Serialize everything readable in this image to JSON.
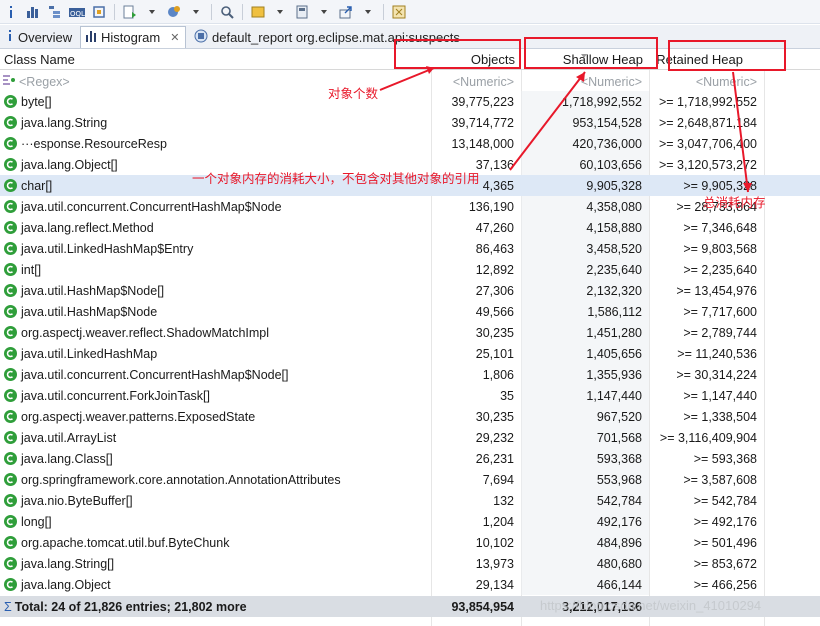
{
  "tabs": [
    {
      "label": "Overview",
      "icon": "info-icon"
    },
    {
      "label": "Histogram",
      "icon": "histogram-icon"
    },
    {
      "label": "default_report  org.eclipse.mat.api:suspects",
      "icon": "report-icon"
    }
  ],
  "columns": {
    "class_name": "Class Name",
    "objects": "Objects",
    "shallow": "Shallow Heap",
    "retained": "Retained Heap"
  },
  "filters": {
    "regex": "<Regex>",
    "objects": "<Numeric>",
    "shallow": "<Numeric>",
    "retained": "<Numeric>"
  },
  "rows": [
    {
      "name": "byte[]",
      "objects": "39,775,223",
      "shallow": "1,718,992,552",
      "retained": ">= 1,718,992,552"
    },
    {
      "name": "java.lang.String",
      "objects": "39,714,772",
      "shallow": "953,154,528",
      "retained": ">= 2,648,871,184"
    },
    {
      "name": "···esponse.ResourceResp",
      "objects": "13,148,000",
      "shallow": "420,736,000",
      "retained": ">= 3,047,706,400"
    },
    {
      "name": "java.lang.Object[]",
      "objects": "37,136",
      "shallow": "60,103,656",
      "retained": ">= 3,120,573,272"
    },
    {
      "name": "char[]",
      "objects": "4,365",
      "shallow": "9,905,328",
      "retained": ">= 9,905,328"
    },
    {
      "name": "java.util.concurrent.ConcurrentHashMap$Node",
      "objects": "136,190",
      "shallow": "4,358,080",
      "retained": ">= 28,733,864"
    },
    {
      "name": "java.lang.reflect.Method",
      "objects": "47,260",
      "shallow": "4,158,880",
      "retained": ">= 7,346,648"
    },
    {
      "name": "java.util.LinkedHashMap$Entry",
      "objects": "86,463",
      "shallow": "3,458,520",
      "retained": ">= 9,803,568"
    },
    {
      "name": "int[]",
      "objects": "12,892",
      "shallow": "2,235,640",
      "retained": ">= 2,235,640"
    },
    {
      "name": "java.util.HashMap$Node[]",
      "objects": "27,306",
      "shallow": "2,132,320",
      "retained": ">= 13,454,976"
    },
    {
      "name": "java.util.HashMap$Node",
      "objects": "49,566",
      "shallow": "1,586,112",
      "retained": ">= 7,717,600"
    },
    {
      "name": "org.aspectj.weaver.reflect.ShadowMatchImpl",
      "objects": "30,235",
      "shallow": "1,451,280",
      "retained": ">= 2,789,744"
    },
    {
      "name": "java.util.LinkedHashMap",
      "objects": "25,101",
      "shallow": "1,405,656",
      "retained": ">= 11,240,536"
    },
    {
      "name": "java.util.concurrent.ConcurrentHashMap$Node[]",
      "objects": "1,806",
      "shallow": "1,355,936",
      "retained": ">= 30,314,224"
    },
    {
      "name": "java.util.concurrent.ForkJoinTask[]",
      "objects": "35",
      "shallow": "1,147,440",
      "retained": ">= 1,147,440"
    },
    {
      "name": "org.aspectj.weaver.patterns.ExposedState",
      "objects": "30,235",
      "shallow": "967,520",
      "retained": ">= 1,338,504"
    },
    {
      "name": "java.util.ArrayList",
      "objects": "29,232",
      "shallow": "701,568",
      "retained": ">= 3,116,409,904"
    },
    {
      "name": "java.lang.Class[]",
      "objects": "26,231",
      "shallow": "593,368",
      "retained": ">= 593,368"
    },
    {
      "name": "org.springframework.core.annotation.AnnotationAttributes",
      "objects": "7,694",
      "shallow": "553,968",
      "retained": ">= 3,587,608"
    },
    {
      "name": "java.nio.ByteBuffer[]",
      "objects": "132",
      "shallow": "542,784",
      "retained": ">= 542,784"
    },
    {
      "name": "long[]",
      "objects": "1,204",
      "shallow": "492,176",
      "retained": ">= 492,176"
    },
    {
      "name": "org.apache.tomcat.util.buf.ByteChunk",
      "objects": "10,102",
      "shallow": "484,896",
      "retained": ">= 501,496"
    },
    {
      "name": "java.lang.String[]",
      "objects": "13,973",
      "shallow": "480,680",
      "retained": ">= 853,672"
    },
    {
      "name": "java.lang.Object",
      "objects": "29,134",
      "shallow": "466,144",
      "retained": ">= 466,256"
    }
  ],
  "total": {
    "label": "Total: 24 of 21,826 entries; 21,802 more",
    "objects": "93,854,954",
    "shallow": "3,212,017,136"
  },
  "annotations": {
    "objects_note": "对象个数",
    "shallow_note": "一个对象内存的消耗大小，不包含对其他对象的引用",
    "retained_note": "总消耗内存",
    "color": "#e8182a"
  },
  "watermark": "https://blog.csdn.net/weixin_41010294",
  "colors": {
    "class_icon": "#2f9e3a",
    "selected_row": "#dde8f6",
    "total_row": "#d9dde3"
  }
}
